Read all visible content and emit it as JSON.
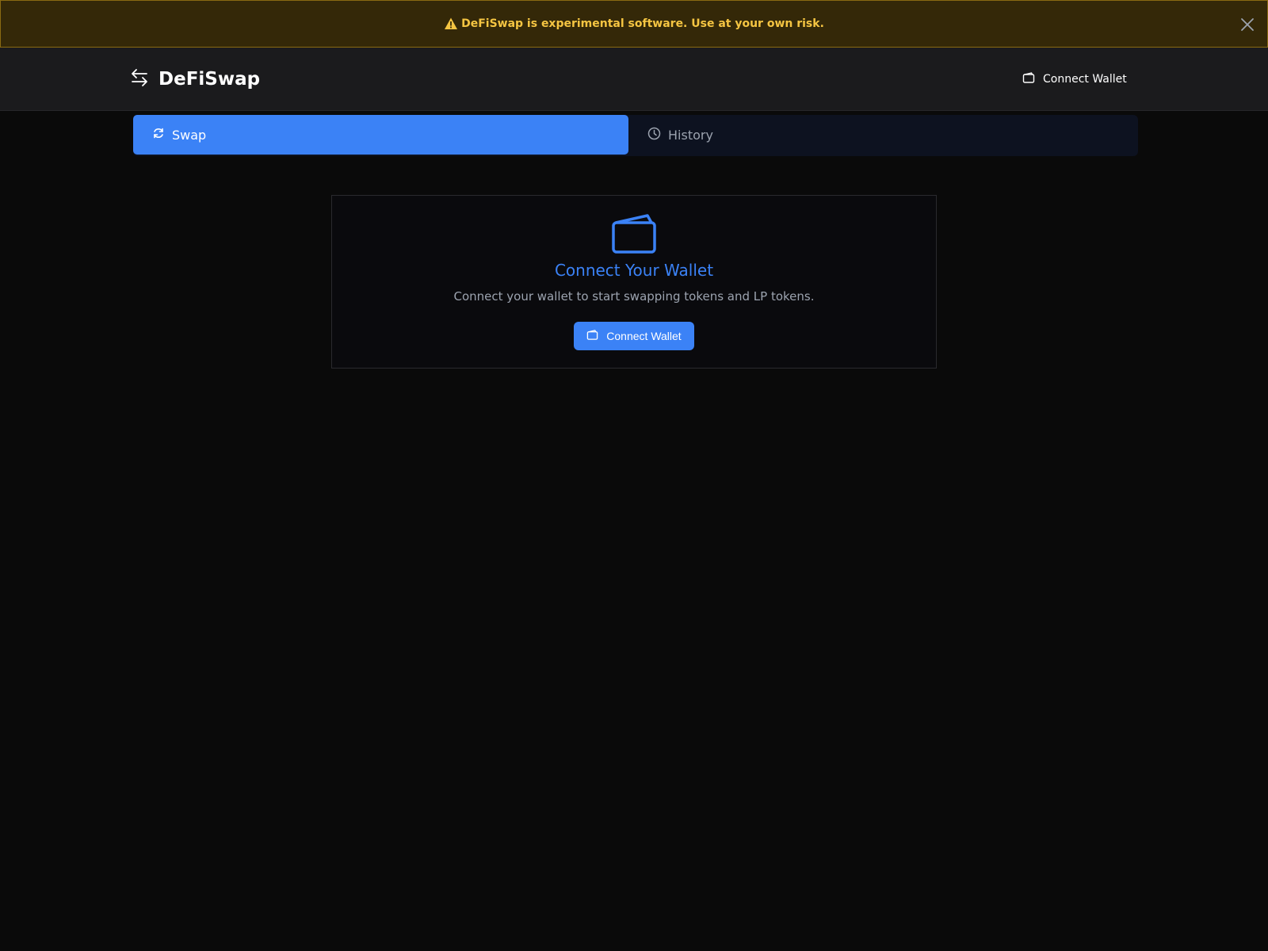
{
  "banner": {
    "message": "DeFiSwap is experimental software. Use at your own risk.",
    "icon": "warning-icon",
    "close_icon": "close-icon",
    "colors": {
      "background": "#342808",
      "text": "#f5c542"
    }
  },
  "header": {
    "brand": "DeFiSwap",
    "brand_icon": "swap-arrows-icon",
    "connect_label": "Connect Wallet",
    "connect_icon": "wallet-icon"
  },
  "tabs": [
    {
      "label": "Swap",
      "icon": "refresh-icon",
      "active": true
    },
    {
      "label": "History",
      "icon": "clock-icon",
      "active": false
    }
  ],
  "card": {
    "icon": "wallet-icon",
    "title": "Connect Your Wallet",
    "description": "Connect your wallet to start swapping tokens and LP tokens.",
    "button_label": "Connect Wallet",
    "button_icon": "wallet-icon"
  },
  "colors": {
    "accent": "#3b82f6",
    "background": "#0a0a0a",
    "header": "#1b1b1d"
  }
}
